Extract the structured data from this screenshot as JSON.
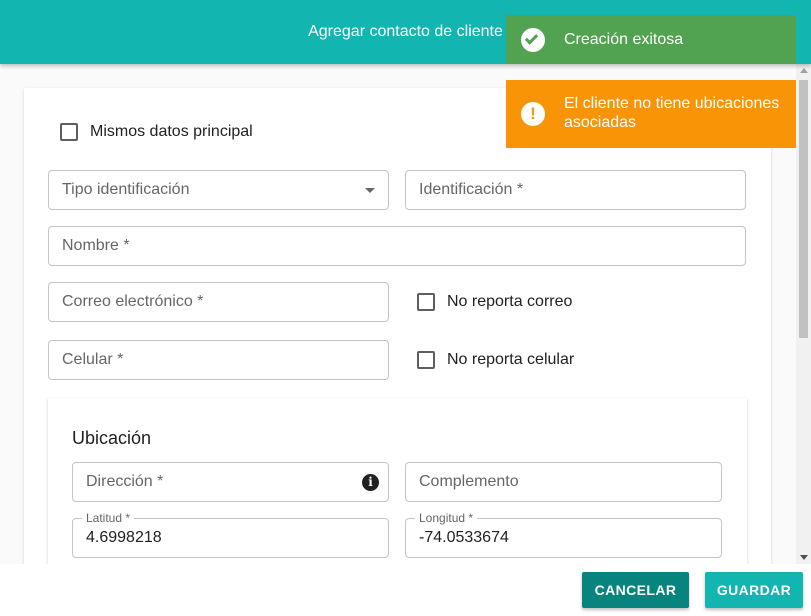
{
  "header": {
    "title": "Agregar contacto de cliente"
  },
  "form": {
    "same_data_label": "Mismos datos principal",
    "tipo_identificacion_placeholder": "Tipo identificación",
    "identificacion_placeholder": "Identificación *",
    "nombre_placeholder": "Nombre *",
    "correo_placeholder": "Correo electrónico *",
    "no_correo_label": "No reporta correo",
    "celular_placeholder": "Celular *",
    "no_celular_label": "No reporta celular"
  },
  "ubicacion": {
    "title": "Ubicación",
    "direccion_placeholder": "Dirección *",
    "complemento_placeholder": "Complemento",
    "latitud_label": "Latitud *",
    "latitud_value": "4.6998218",
    "longitud_label": "Longitud *",
    "longitud_value": "-74.0533674"
  },
  "actions": {
    "cancel_label": "CANCELAR",
    "save_label": "GUARDAR"
  },
  "toasts": {
    "success_text": "Creación exitosa",
    "warning_text": "El cliente no tiene ubicaciones asociadas"
  },
  "icons": {
    "success": "check-circle-icon",
    "warning": "exclamation-circle-icon",
    "info": "info-icon",
    "dropdown": "chevron-down-icon"
  },
  "colors": {
    "primary": "#13b5b1",
    "primary_dark": "#08847f",
    "success": "#51a351",
    "warning": "#f89406"
  }
}
